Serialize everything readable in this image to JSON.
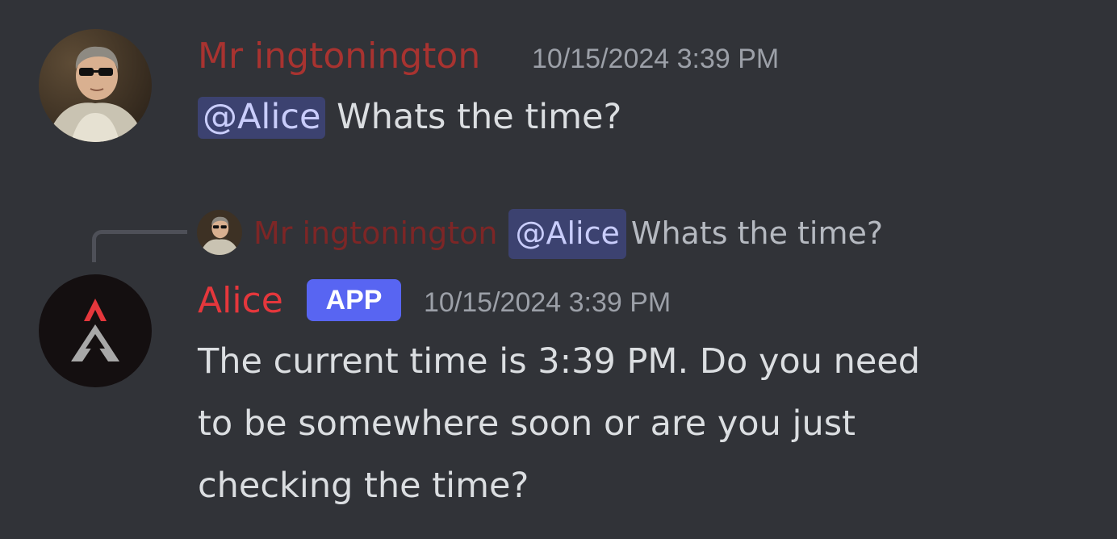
{
  "messages": [
    {
      "author": "Mr ingtonington",
      "timestamp": "10/15/2024 3:39 PM",
      "mention": "@Alice",
      "text": " Whats the time?",
      "author_color": "#a83330",
      "avatar_icon": "portrait-with-sunglasses-icon"
    },
    {
      "reply_to": {
        "author": "Mr ingtonington",
        "mention": "@Alice",
        "text": "Whats the time?",
        "author_color": "#7d2626"
      },
      "author": "Alice",
      "badge": "APP",
      "timestamp": "10/15/2024 3:39 PM",
      "text_lines": [
        "The current time is 3:39 PM. Do you need",
        "to be somewhere soon or are you just",
        "checking the time?"
      ],
      "author_color": "#e5373c",
      "avatar_icon": "alice-a-logo-icon"
    }
  ],
  "colors": {
    "background": "#313338",
    "mention_bg": "#3c4270",
    "mention_text": "#c9cdfb",
    "badge_bg": "#5865f2"
  }
}
